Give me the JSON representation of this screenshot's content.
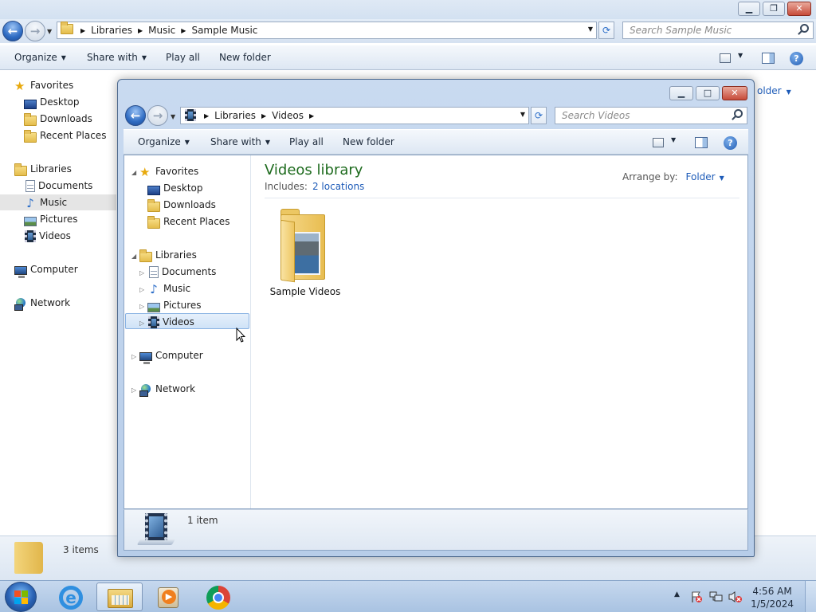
{
  "background_window": {
    "breadcrumb": [
      "Libraries",
      "Music",
      "Sample Music"
    ],
    "search_placeholder": "Search Sample Music",
    "toolbar": {
      "organize": "Organize",
      "share_with": "Share with",
      "play_all": "Play all",
      "new_folder": "New folder"
    },
    "nav": {
      "favorites": "Favorites",
      "desktop": "Desktop",
      "downloads": "Downloads",
      "recent_places": "Recent Places",
      "libraries": "Libraries",
      "documents": "Documents",
      "music": "Music",
      "pictures": "Pictures",
      "videos": "Videos",
      "computer": "Computer",
      "network": "Network"
    },
    "arrange_partial": "older",
    "status": "3 items"
  },
  "foreground_window": {
    "breadcrumb": [
      "Libraries",
      "Videos"
    ],
    "search_placeholder": "Search Videos",
    "toolbar": {
      "organize": "Organize",
      "share_with": "Share with",
      "play_all": "Play all",
      "new_folder": "New folder"
    },
    "nav": {
      "favorites": "Favorites",
      "desktop": "Desktop",
      "downloads": "Downloads",
      "recent_places": "Recent Places",
      "libraries": "Libraries",
      "documents": "Documents",
      "music": "Music",
      "pictures": "Pictures",
      "videos": "Videos",
      "computer": "Computer",
      "network": "Network"
    },
    "library_title": "Videos library",
    "includes_label": "Includes:",
    "includes_link": "2 locations",
    "arrange_label": "Arrange by:",
    "arrange_value": "Folder",
    "items": [
      {
        "name": "Sample Videos"
      }
    ],
    "status": "1 item"
  },
  "taskbar": {
    "time": "4:56 AM",
    "date": "1/5/2024"
  }
}
